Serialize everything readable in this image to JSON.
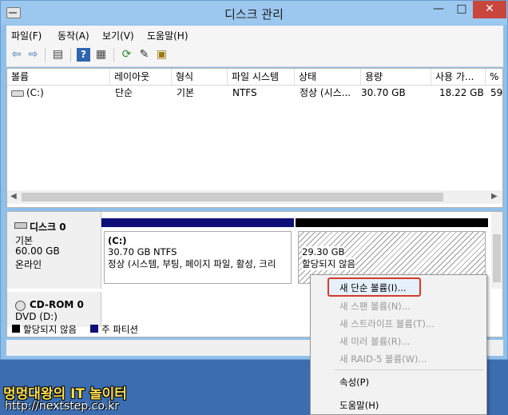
{
  "window": {
    "title": "디스크 관리",
    "min_label": "—",
    "max_label": "□",
    "close_label": "✕"
  },
  "menu": [
    "파일(F)",
    "동작(A)",
    "보기(V)",
    "도움말(H)"
  ],
  "toolbar_icons": [
    "back-arrow-icon",
    "forward-arrow-icon",
    "console-tree-icon",
    "help-icon",
    "show-hide-icon",
    "refresh-icon",
    "properties-icon",
    "rescan-icon"
  ],
  "volume_list": {
    "columns": [
      "볼륨",
      "레이아웃",
      "형식",
      "파일 시스템",
      "상태",
      "용량",
      "사용 가...",
      "%"
    ],
    "rows": [
      [
        "(C:)",
        "단순",
        "기본",
        "NTFS",
        "정상 (시스...",
        "30.70 GB",
        "18.22 GB",
        "59"
      ]
    ]
  },
  "disk0": {
    "name": "디스크 0",
    "type": "기본",
    "size": "60.00 GB",
    "status": "온라인",
    "partition_c": {
      "name": "(C:)",
      "size": "30.70 GB NTFS",
      "status": "정상 (시스템, 부팅, 페이지 파일, 활성, 크리"
    },
    "unallocated": {
      "size": "29.30 GB",
      "status": "할당되지 않음"
    }
  },
  "cdrom": {
    "name": "CD-ROM 0",
    "type": "DVD (D:)"
  },
  "legend": {
    "unallocated": "할당되지 않음",
    "primary": "주 파티션"
  },
  "context_menu": {
    "new_simple": "새 단순 볼륨(I)...",
    "new_spanned": "새 스팬 볼륨(N)...",
    "new_striped": "새 스트라이프 볼륨(T)...",
    "new_mirrored": "새 미러 볼륨(R)...",
    "new_raid5": "새 RAID-5 볼륨(W)...",
    "properties": "속성(P)",
    "help": "도움말(H)"
  },
  "watermark": {
    "line1": "멍멍대왕의 IT 놀이터",
    "line2": "http://nextstep.co.kr"
  },
  "colors": {
    "primary_partition": "#0f0f7a",
    "unallocated": "#000000",
    "highlight_border": "#d33b2c"
  }
}
